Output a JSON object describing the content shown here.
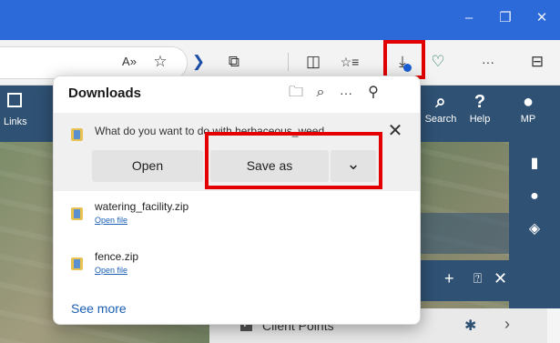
{
  "browser": {
    "window_controls": {
      "minimize": "–",
      "restore": "❐",
      "close": "✕"
    },
    "toolbar_icons": {
      "read_aloud": "A»",
      "favorite": "☆",
      "extension": "❯",
      "extensions": "⧉",
      "split_screen": "◫",
      "favorites": "☆≡",
      "downloads": "⤓",
      "health": "♡",
      "more": "···",
      "sidebar_toggle": "⊟"
    }
  },
  "app": {
    "header": {
      "links_label": "Links",
      "search_label": "Search",
      "help_label": "Help",
      "user_initials": "MP",
      "search_icon": "⌕",
      "help_icon": "?",
      "user_icon": "●"
    },
    "legend": {
      "layer_label": "Client Points"
    }
  },
  "downloads": {
    "title": "Downloads",
    "prompt": {
      "text": "What do you want to do with herbaceous_weed",
      "open_label": "Open",
      "save_as_label": "Save as",
      "dropdown_icon": "⌄",
      "close_icon": "✕"
    },
    "items": [
      {
        "name": "watering_facility.zip",
        "link": "Open file"
      },
      {
        "name": "fence.zip",
        "link": "Open file"
      }
    ],
    "see_more": "See more"
  }
}
